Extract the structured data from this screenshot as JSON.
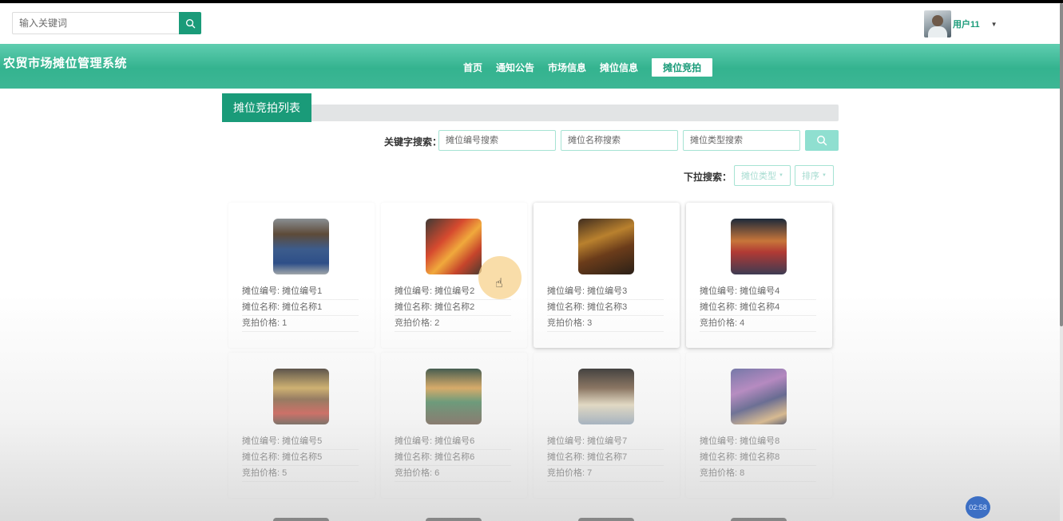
{
  "search": {
    "placeholder": "输入关键词"
  },
  "user": {
    "name": "用户11"
  },
  "site": {
    "title": "农贸市场摊位管理系统"
  },
  "nav": {
    "items": [
      {
        "label": "首页"
      },
      {
        "label": "通知公告"
      },
      {
        "label": "市场信息"
      },
      {
        "label": "摊位信息"
      },
      {
        "label": "摊位竞拍",
        "active": true
      }
    ]
  },
  "section": {
    "title": "摊位竞拍列表"
  },
  "filters": {
    "keyword_label": "关键字搜索：",
    "inputs": [
      {
        "placeholder": "摊位编号搜索"
      },
      {
        "placeholder": "摊位名称搜索"
      },
      {
        "placeholder": "摊位类型搜索"
      }
    ],
    "dropdown_label": "下拉搜索：",
    "dropdowns": [
      {
        "label": "摊位类型"
      },
      {
        "label": "排序"
      }
    ]
  },
  "card_labels": {
    "code": "摊位编号:",
    "name": "摊位名称:",
    "price": "竞拍价格:"
  },
  "cards": [
    {
      "code": "摊位编号1",
      "name": "摊位名称1",
      "price": "1"
    },
    {
      "code": "摊位编号2",
      "name": "摊位名称2",
      "price": "2"
    },
    {
      "code": "摊位编号3",
      "name": "摊位名称3",
      "price": "3"
    },
    {
      "code": "摊位编号4",
      "name": "摊位名称4",
      "price": "4"
    },
    {
      "code": "摊位编号5",
      "name": "摊位名称5",
      "price": "5"
    },
    {
      "code": "摊位编号6",
      "name": "摊位名称6",
      "price": "6"
    },
    {
      "code": "摊位编号7",
      "name": "摊位名称7",
      "price": "7"
    },
    {
      "code": "摊位编号8",
      "name": "摊位名称8",
      "price": "8"
    }
  ],
  "recording": {
    "timer": "02:58"
  },
  "colors": {
    "primary": "#1a9b79",
    "header_gradient_top": "#5fcdb0",
    "light_accent": "#8fdfd0"
  },
  "icons": {
    "search": "search-icon",
    "caret": "caret-down-icon",
    "cursor": "hand-pointer-icon"
  }
}
